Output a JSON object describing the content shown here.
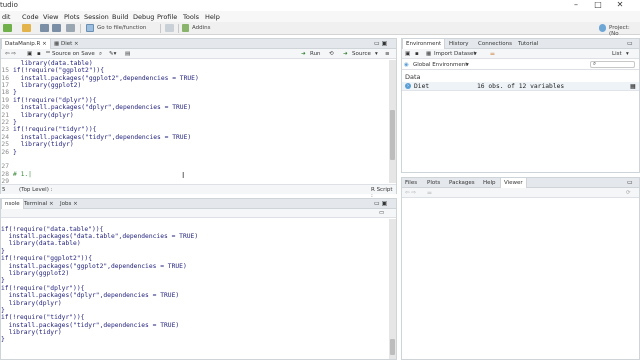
{
  "window": {
    "title": "tudio",
    "project": "Project: (No"
  },
  "menu": [
    "dit",
    "Code",
    "View",
    "Plots",
    "Session",
    "Build",
    "Debug",
    "Profile",
    "Tools",
    "Help"
  ],
  "toolbar": {
    "goto_placeholder": "Go to file/function",
    "addins": "Addins"
  },
  "source": {
    "tabs": [
      "DataManip.R",
      "Diet"
    ],
    "source_on_save": "Source on Save",
    "run": "Run",
    "source_btn": "Source",
    "lines": [
      {
        "n": "",
        "text": "  library(data.table)"
      },
      {
        "n": "15",
        "text": "if(!require(\"ggplot2\")){"
      },
      {
        "n": "16",
        "text": "  install.packages(\"ggplot2\",dependencies = TRUE)"
      },
      {
        "n": "17",
        "text": "  library(ggplot2)"
      },
      {
        "n": "18",
        "text": "}"
      },
      {
        "n": "19",
        "text": "if(!require(\"dplyr\")){"
      },
      {
        "n": "20",
        "text": "  install.packages(\"dplyr\",dependencies = TRUE)"
      },
      {
        "n": "21",
        "text": "  library(dplyr)"
      },
      {
        "n": "22",
        "text": "}"
      },
      {
        "n": "23",
        "text": "if(!require(\"tidyr\")){"
      },
      {
        "n": "24",
        "text": "  install.packages(\"tidyr\",dependencies = TRUE)"
      },
      {
        "n": "25",
        "text": "  library(tidyr)"
      },
      {
        "n": "26",
        "text": "}"
      },
      {
        "n": "27",
        "text": ""
      },
      {
        "n": "28",
        "text": "# 1.|"
      },
      {
        "n": "29",
        "text": ""
      }
    ],
    "status_pos": "5",
    "status_level": "(Top Level) :",
    "status_type": "R Script :"
  },
  "console": {
    "tabs": [
      "nsole",
      "Terminal",
      "Jobs"
    ],
    "lines": [
      "if(!require(\"data.table\")){",
      "  install.packages(\"data.table\",dependencies = TRUE)",
      "  library(data.table)",
      "}",
      "if(!require(\"ggplot2\")){",
      "  install.packages(\"ggplot2\",dependencies = TRUE)",
      "  library(ggplot2)",
      "}",
      "if(!require(\"dplyr\")){",
      "  install.packages(\"dplyr\",dependencies = TRUE)",
      "  library(dplyr)",
      "}",
      "if(!require(\"tidyr\")){",
      "  install.packages(\"tidyr\",dependencies = TRUE)",
      "  library(tidyr)",
      "}"
    ]
  },
  "environment": {
    "tabs": [
      "Environment",
      "History",
      "Connections",
      "Tutorial"
    ],
    "import_label": "Import Dataset",
    "list_label": "List",
    "scope": "Global Environment",
    "section": "Data",
    "rows": [
      {
        "name": "Diet",
        "value": "16 obs. of 12 variables"
      }
    ]
  },
  "files": {
    "tabs": [
      "Files",
      "Plots",
      "Packages",
      "Help",
      "Viewer"
    ]
  },
  "colors": {
    "accent": "#5a9ed6",
    "pane_border": "#cfd4d9",
    "tab_bg": "#e4e8ec"
  }
}
